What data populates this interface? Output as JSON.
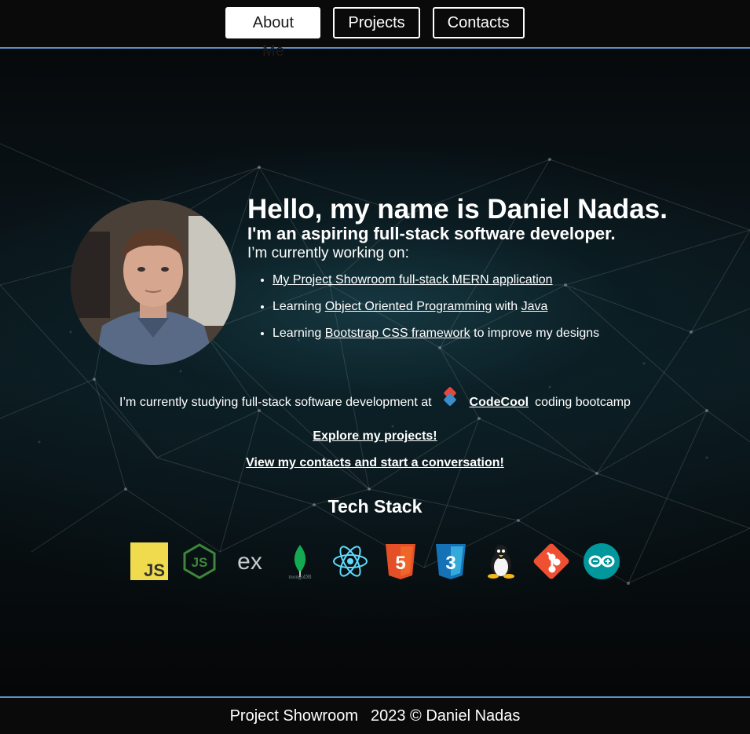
{
  "nav": {
    "items": [
      {
        "label": "About Me",
        "active": true
      },
      {
        "label": "Projects",
        "active": false
      },
      {
        "label": "Contacts",
        "active": false
      }
    ]
  },
  "intro": {
    "title": "Hello, my name is Daniel Nadas.",
    "subtitle": "I'm an aspiring full-stack software developer.",
    "working_on": "I’m currently working on:",
    "items": [
      {
        "link1": "My Project Showroom full-stack MERN application"
      },
      {
        "prefix": "Learning ",
        "link1": "Object Oriented Programming",
        "middle": " with ",
        "link2": "Java"
      },
      {
        "prefix": "Learning ",
        "link1": "Bootstrap CSS framework",
        "suffix": " to improve my designs"
      }
    ]
  },
  "study": {
    "prefix": "I’m currently studying full-stack software development at",
    "school": "CodeCool",
    "suffix": "coding bootcamp"
  },
  "cta": {
    "projects": "Explore my projects!",
    "contacts": "View my contacts and start a conversation!"
  },
  "tech_stack": {
    "title": "Tech Stack",
    "icons": [
      "javascript-icon",
      "nodejs-icon",
      "express-icon",
      "mongodb-icon",
      "react-icon",
      "html5-icon",
      "css3-icon",
      "linux-icon",
      "git-icon",
      "arduino-icon"
    ],
    "mongodb_caption": "mongoDB"
  },
  "footer": {
    "brand": "Project Showroom",
    "copyright": "2023 © Daniel Nadas"
  },
  "colors": {
    "accent_border": "#5b8fc7",
    "background": "#0a0a0a",
    "text": "#ffffff"
  }
}
